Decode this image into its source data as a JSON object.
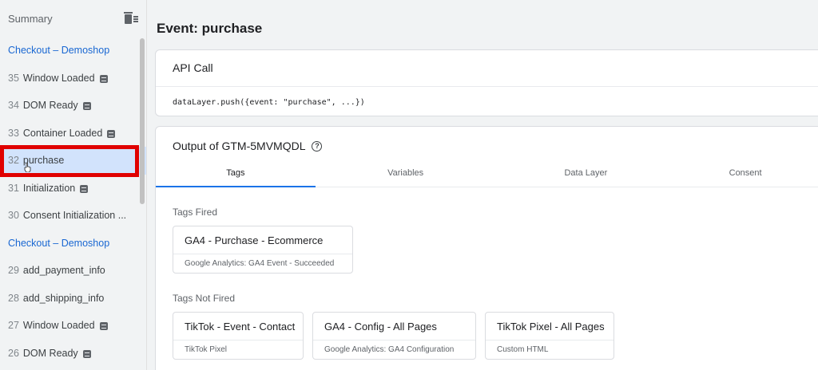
{
  "sidebar": {
    "title": "Summary",
    "items": [
      {
        "kind": "group",
        "label": "Checkout – Demoshop"
      },
      {
        "kind": "event",
        "num": "35",
        "label": "Window Loaded",
        "badge": true
      },
      {
        "kind": "event",
        "num": "34",
        "label": "DOM Ready",
        "badge": true
      },
      {
        "kind": "event",
        "num": "33",
        "label": "Container Loaded",
        "badge": true
      },
      {
        "kind": "event",
        "num": "32",
        "label": "purchase",
        "badge": false,
        "selected": true
      },
      {
        "kind": "event",
        "num": "31",
        "label": "Initialization",
        "badge": true
      },
      {
        "kind": "event",
        "num": "30",
        "label": "Consent Initialization ...",
        "badge": false
      },
      {
        "kind": "group",
        "label": "Checkout – Demoshop"
      },
      {
        "kind": "event",
        "num": "29",
        "label": "add_payment_info",
        "badge": false
      },
      {
        "kind": "event",
        "num": "28",
        "label": "add_shipping_info",
        "badge": false
      },
      {
        "kind": "event",
        "num": "27",
        "label": "Window Loaded",
        "badge": true
      },
      {
        "kind": "event",
        "num": "26",
        "label": "DOM Ready",
        "badge": true
      }
    ]
  },
  "main": {
    "event_title": "Event: purchase",
    "api_call": {
      "title": "API Call",
      "code": "dataLayer.push({event: \"purchase\", ...})"
    },
    "output": {
      "title": "Output of GTM-5MVMQDL",
      "tabs": [
        "Tags",
        "Variables",
        "Data Layer",
        "Consent"
      ],
      "active_tab": "Tags",
      "tags_fired_label": "Tags Fired",
      "tags_fired": [
        {
          "name": "GA4 - Purchase - Ecommerce",
          "type": "Google Analytics: GA4 Event - Succeeded"
        }
      ],
      "tags_not_fired_label": "Tags Not Fired",
      "tags_not_fired": [
        {
          "name": "TikTok - Event - Contact",
          "type": "TikTok Pixel"
        },
        {
          "name": "GA4 - Config - All Pages",
          "type": "Google Analytics: GA4 Configuration"
        },
        {
          "name": "TikTok Pixel - All Pages",
          "type": "Custom HTML"
        }
      ]
    }
  },
  "colors": {
    "accent": "#1a73e8",
    "selected_bg": "#d2e3fc",
    "highlight_outline": "#e00000"
  }
}
